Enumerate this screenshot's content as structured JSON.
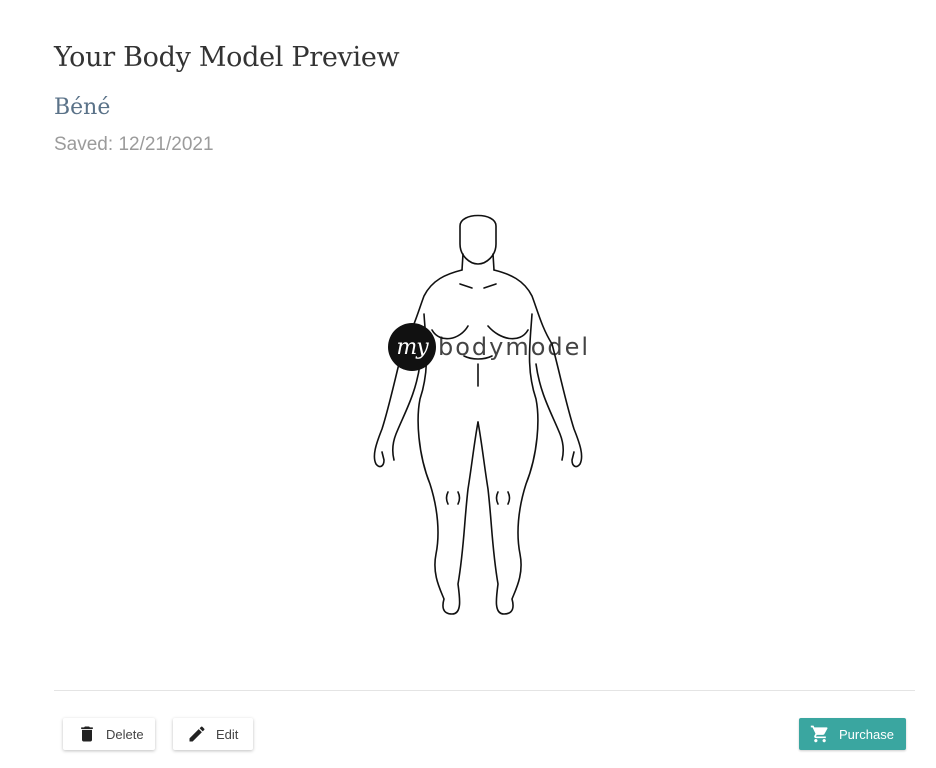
{
  "page": {
    "title": "Your Body Model Preview",
    "model_name": "Béné",
    "saved_label": "Saved:",
    "saved_date": "12/21/2021"
  },
  "watermark": {
    "circle_text": "my",
    "text": "bodymodel"
  },
  "figure": {
    "icon": "body-outline-figure"
  },
  "actions": {
    "delete_label": "Delete",
    "delete_icon": "trash-icon",
    "edit_label": "Edit",
    "edit_icon": "pencil-icon",
    "purchase_label": "Purchase",
    "purchase_icon": "cart-icon"
  },
  "colors": {
    "title": "#333333",
    "model_name": "#5a7288",
    "saved_text": "#9b9b9b",
    "purchase_button": "#3aa6a0"
  }
}
